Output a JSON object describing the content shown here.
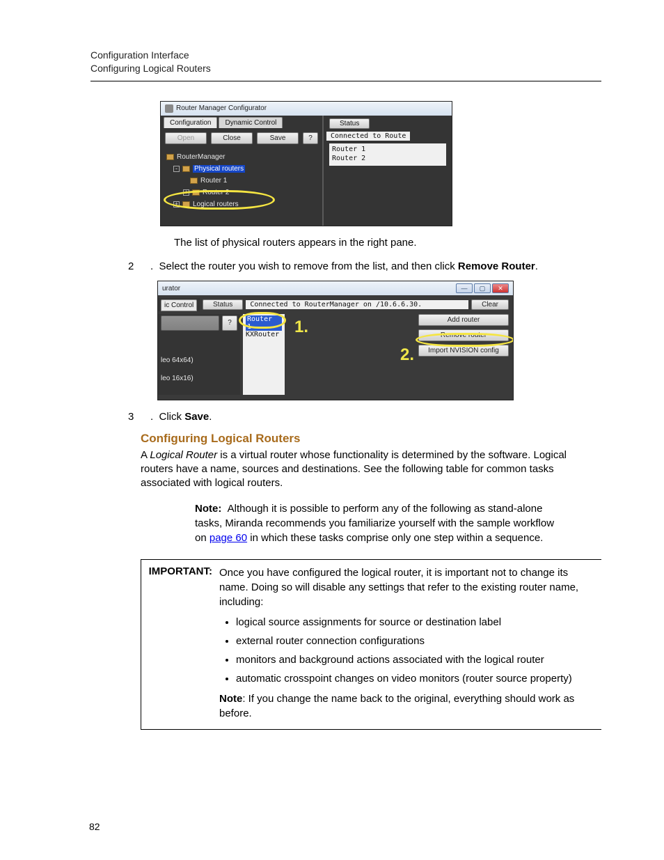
{
  "header": {
    "line1": "Configuration Interface",
    "line2": "Configuring Logical Routers"
  },
  "shot1": {
    "title": "Router Manager Configurator",
    "tabs": {
      "config": "Configuration",
      "dynamic": "Dynamic Control"
    },
    "buttons": {
      "open": "Open",
      "close": "Close",
      "save": "Save",
      "help": "?"
    },
    "tree": {
      "root": "RouterManager",
      "phys": "Physical routers",
      "r1": "Router 1",
      "r2": "Router 2",
      "log": "Logical routers"
    },
    "status_label": "Status",
    "status_value": "Connected to Route",
    "routers": {
      "r1": "Router 1",
      "r2": "Router 2"
    }
  },
  "line_physlist": "The list of physical routers appears in the right pane.",
  "step2": {
    "num": "2",
    "text_a": "Select the router you wish to remove from the list, and then click ",
    "bold": "Remove Router",
    "text_b": "."
  },
  "shot2": {
    "title_frag": "urator",
    "tab": "ic Control",
    "status_label": "Status",
    "status_value": "Connected to RouterManager on /10.6.6.30.",
    "clear": "Clear",
    "help": "?",
    "list": {
      "r1": "Router 1",
      "kx": "KXRouter"
    },
    "left_items": {
      "a": "leo 64x64)",
      "b": "leo 16x16)"
    },
    "buttons": {
      "add": "Add router",
      "remove": "Remove router",
      "import": "Import NVISION config"
    },
    "anno1": "1.",
    "anno2": "2.",
    "win": {
      "min": "—",
      "max": "▢",
      "close": "✕"
    }
  },
  "step3": {
    "num": "3",
    "text_a": "Click ",
    "bold": "Save",
    "text_b": "."
  },
  "h3": "Configuring Logical Routers",
  "para1": {
    "a": "A ",
    "i": "Logical Router",
    "b": " is a virtual router whose functionality is determined by the software. Logical routers have a name, sources and destinations. See the following table for common tasks associated with logical routers."
  },
  "note": {
    "label": "Note:",
    "a": "Although it is possible to perform any of the following as stand-alone tasks, Miranda recommends you familiarize yourself with the sample workflow on ",
    "link": "page 60",
    "b": " in which these tasks comprise only one step within a sequence."
  },
  "important": {
    "label": "IMPORTANT:",
    "intro": "Once you have configured the logical router, it is important not to change its name. Doing so will disable any settings that refer to the existing router name, including:",
    "bullets": [
      "logical source assignments for source or destination label",
      "external router connection configurations",
      "monitors and background actions associated with the logical router",
      "automatic crosspoint changes on video monitors (router source property)"
    ],
    "note_label": "Note",
    "note_text": ": If you change the name back to the original, everything should work as before."
  },
  "page_number": "82"
}
